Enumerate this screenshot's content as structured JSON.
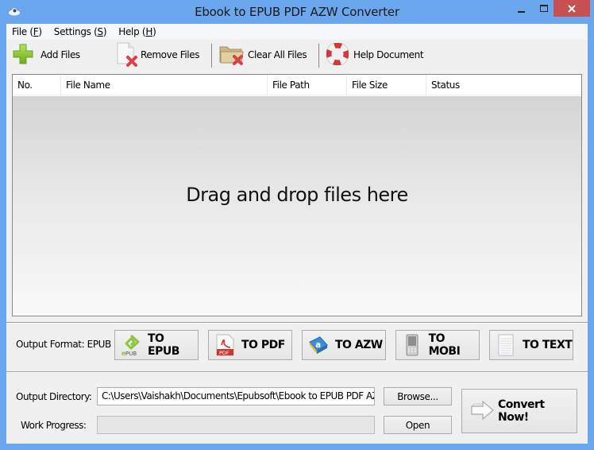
{
  "window": {
    "title": "Ebook to EPUB PDF AZW Converter",
    "controls": {
      "minimize": "—",
      "maximize": "☐",
      "close": "✕"
    }
  },
  "menu": [
    {
      "label": "File",
      "mnemonic": "F"
    },
    {
      "label": "Settings",
      "mnemonic": "S"
    },
    {
      "label": "Help",
      "mnemonic": "H"
    }
  ],
  "toolbar": {
    "add_files": "Add Files",
    "remove_files": "Remove Files",
    "clear_all_files": "Clear All Files",
    "help_document": "Help Document"
  },
  "file_list": {
    "columns": [
      "No.",
      "File Name",
      "File Path",
      "File Size",
      "Status"
    ],
    "rows": [],
    "empty_message": "Drag and drop files here"
  },
  "output_format": {
    "label": "Output Format: EPUB",
    "selected": "EPUB",
    "buttons": [
      {
        "label": "TO EPUB",
        "icon": "epub-icon"
      },
      {
        "label": "TO PDF",
        "icon": "pdf-icon"
      },
      {
        "label": "TO AZW",
        "icon": "azw-book-icon"
      },
      {
        "label": "TO MOBI",
        "icon": "mobile-device-icon"
      },
      {
        "label": "TO TEXT",
        "icon": "text-document-icon"
      }
    ]
  },
  "output": {
    "directory_label": "Output Directory:",
    "directory_value": "C:\\Users\\Vaishakh\\Documents\\Epubsoft\\Ebook to EPUB PDF AZW Converter",
    "browse_button": "Browse...",
    "progress_label": "Work Progress:",
    "progress_percent": 0,
    "open_button": "Open",
    "convert_button": "Convert Now!"
  }
}
